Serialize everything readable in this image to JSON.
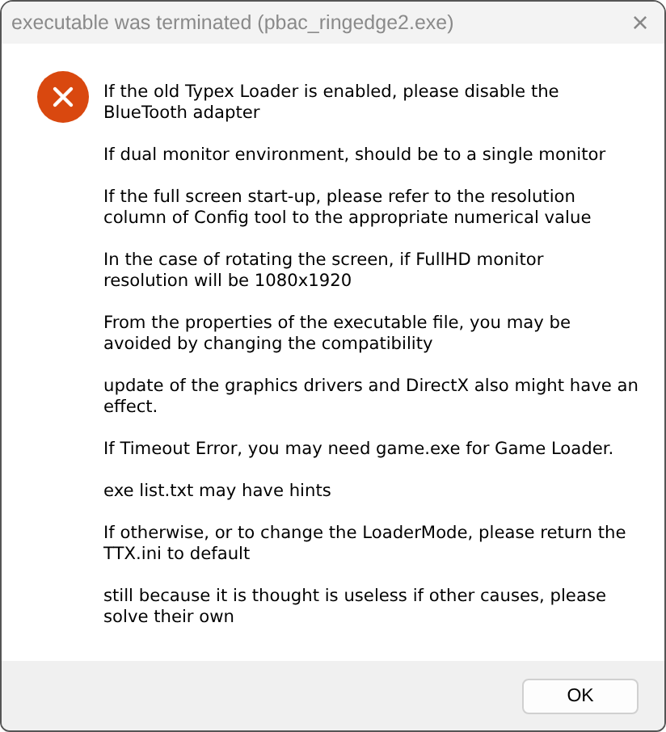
{
  "window": {
    "title": "executable was terminated (pbac_ringedge2.exe)",
    "close": "×"
  },
  "message": {
    "paragraphs": [
      {
        "lines": [
          "If the old Typex Loader is enabled, please disable the",
          "BlueTooth adapter"
        ]
      },
      {
        "lines": [
          "If dual monitor environment, should be to a single monitor"
        ]
      },
      {
        "lines": [
          "If the full screen start-up, please refer to the resolution",
          "column of Config tool to the appropriate numerical value"
        ]
      },
      {
        "lines": [
          "In the case of rotating the screen, if FullHD monitor",
          "resolution will be 1080x1920"
        ]
      },
      {
        "lines": [
          "From the properties of the executable file, you may be",
          "avoided by changing the compatibility"
        ]
      },
      {
        "lines": [
          "update of the graphics drivers and DirectX also might have an",
          "effect."
        ]
      },
      {
        "lines": [
          "If Timeout Error, you may need game.exe for Game Loader."
        ]
      },
      {
        "lines": [
          "exe list.txt may have hints"
        ]
      },
      {
        "lines": [
          "If otherwise, or to change the LoaderMode, please return the",
          "TTX.ini to default"
        ]
      },
      {
        "lines": [
          "still because it is thought is useless if other causes, please",
          "solve their own"
        ]
      }
    ]
  },
  "buttons": [
    "OK"
  ]
}
